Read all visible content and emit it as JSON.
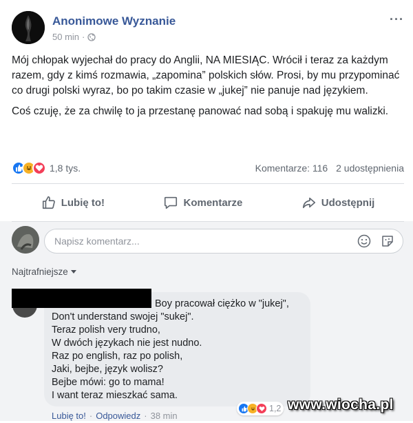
{
  "post": {
    "author": "Anonimowe Wyznanie",
    "time": "50 min",
    "separator": "·",
    "more_label": "···",
    "paragraphs": [
      "Mój chłopak wyjechał do pracy do Anglii, NA MIESIĄC. Wrócił i teraz za każdym razem, gdy z kimś rozmawia, „zapomina” polskich słów. Prosi, by mu przypominać co drugi polski wyraz, bo po takim czasie w „jukej” nie panuje nad językiem.",
      "Coś czuję, że za chwilę to ja przestanę panować nad sobą i spakuję mu walizki."
    ],
    "reaction_count": "1,8 tys.",
    "comments_count": "Komentarze: 116",
    "shares_count": "2 udostępnienia",
    "reactions": [
      "like-icon",
      "haha-icon",
      "love-icon"
    ],
    "colors": {
      "link": "#385898",
      "like": "#1877f2",
      "haha": "#f7b125",
      "love": "#f33e58"
    }
  },
  "actions": {
    "like": "Lubię to!",
    "comment": "Komentarze",
    "share": "Udostępnij"
  },
  "comment_box": {
    "placeholder": "Napisz komentarz..."
  },
  "sort": {
    "label": "Najtrafniejsze"
  },
  "comment": {
    "lines": [
      "Boy pracował ciężko w \"jukej\",",
      "Don't understand swojej \"sukej\".",
      "Teraz polish very trudno,",
      "W dwóch językach nie jest nudno.",
      "Raz po english, raz po polish,",
      "Jaki, bejbe, język wolisz?",
      "Bejbe mówi: go to mama!",
      "I want teraz mieszkać sama."
    ],
    "reaction_count": "1,2",
    "like_label": "Lubię to!",
    "reply_label": "Odpowiedz",
    "separator": "·",
    "time": "38 min"
  },
  "watermark": "www.wiocha.pl"
}
